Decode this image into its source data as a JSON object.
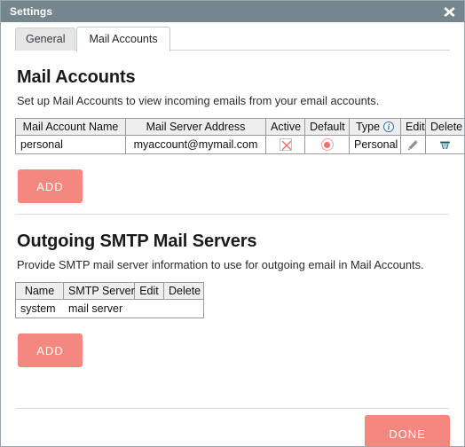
{
  "window": {
    "title": "Settings",
    "close_icon": "close-icon",
    "accent_color": "#f4877e",
    "titlebar_color": "#76868f"
  },
  "tabs": [
    {
      "label": "General",
      "active": false
    },
    {
      "label": "Mail Accounts",
      "active": true
    }
  ],
  "mail_accounts": {
    "heading": "Mail Accounts",
    "description": "Set up Mail Accounts to view incoming emails from your email accounts.",
    "columns": [
      "Mail Account Name",
      "Mail Server Address",
      "Active",
      "Default",
      "Type",
      "Edit",
      "Delete"
    ],
    "type_info_icon": "info-icon",
    "rows": [
      {
        "name": "personal",
        "server": "myaccount@mymail.com",
        "active_icon": "checkbox-x-icon",
        "active_checked": false,
        "default_icon": "radio-selected-icon",
        "default_selected": true,
        "type": "Personal",
        "edit_icon": "pencil-icon",
        "delete_icon": "trash-icon"
      }
    ],
    "add_label": "ADD"
  },
  "smtp": {
    "heading": "Outgoing SMTP Mail Servers",
    "description": "Provide SMTP mail server information to use for outgoing email in Mail Accounts.",
    "columns": [
      "Name",
      "SMTP Server",
      "Edit",
      "Delete"
    ],
    "rows": [
      {
        "name": "system",
        "server": "mail server",
        "edit_icon": "",
        "delete_icon": ""
      }
    ],
    "add_label": "ADD"
  },
  "footer": {
    "done_label": "DONE"
  }
}
